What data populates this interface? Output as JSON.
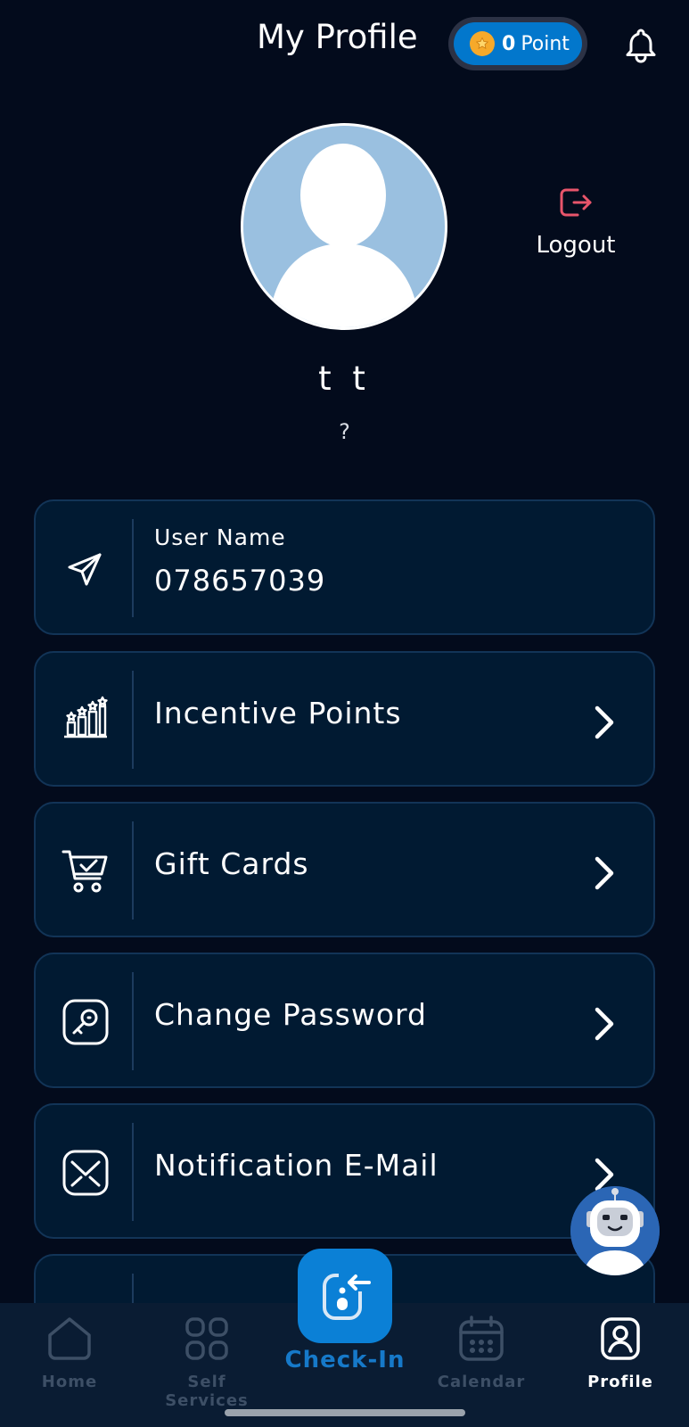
{
  "header": {
    "title": "My Profile",
    "points_value": "0",
    "points_label": "Point"
  },
  "profile": {
    "name": "t t",
    "subtitle": "?",
    "logout_label": "Logout"
  },
  "user_card": {
    "label": "User Name",
    "value": "078657039"
  },
  "menu": [
    {
      "label": "Incentive Points",
      "icon": "bar-chart-stars-icon"
    },
    {
      "label": "Gift Cards",
      "icon": "shopping-cart-check-icon"
    },
    {
      "label": "Change Password",
      "icon": "key-icon"
    },
    {
      "label": "Notification E-Mail",
      "icon": "mail-icon"
    },
    {
      "label": "",
      "icon": "wifi-icon"
    }
  ],
  "tabs": [
    {
      "label": "Home",
      "icon": "home-icon",
      "active": false
    },
    {
      "label": "Self Services",
      "icon": "grid-icon",
      "active": false
    },
    {
      "label": "Check-In",
      "icon": "check-in-icon",
      "active": false
    },
    {
      "label": "Calendar",
      "icon": "calendar-icon",
      "active": false
    },
    {
      "label": "Profile",
      "icon": "profile-icon",
      "active": true
    }
  ],
  "colors": {
    "background": "#030b1c",
    "card": "#011a32",
    "accent": "#0b80d6",
    "logout": "#e8556b",
    "coin": "#f6a92a"
  }
}
